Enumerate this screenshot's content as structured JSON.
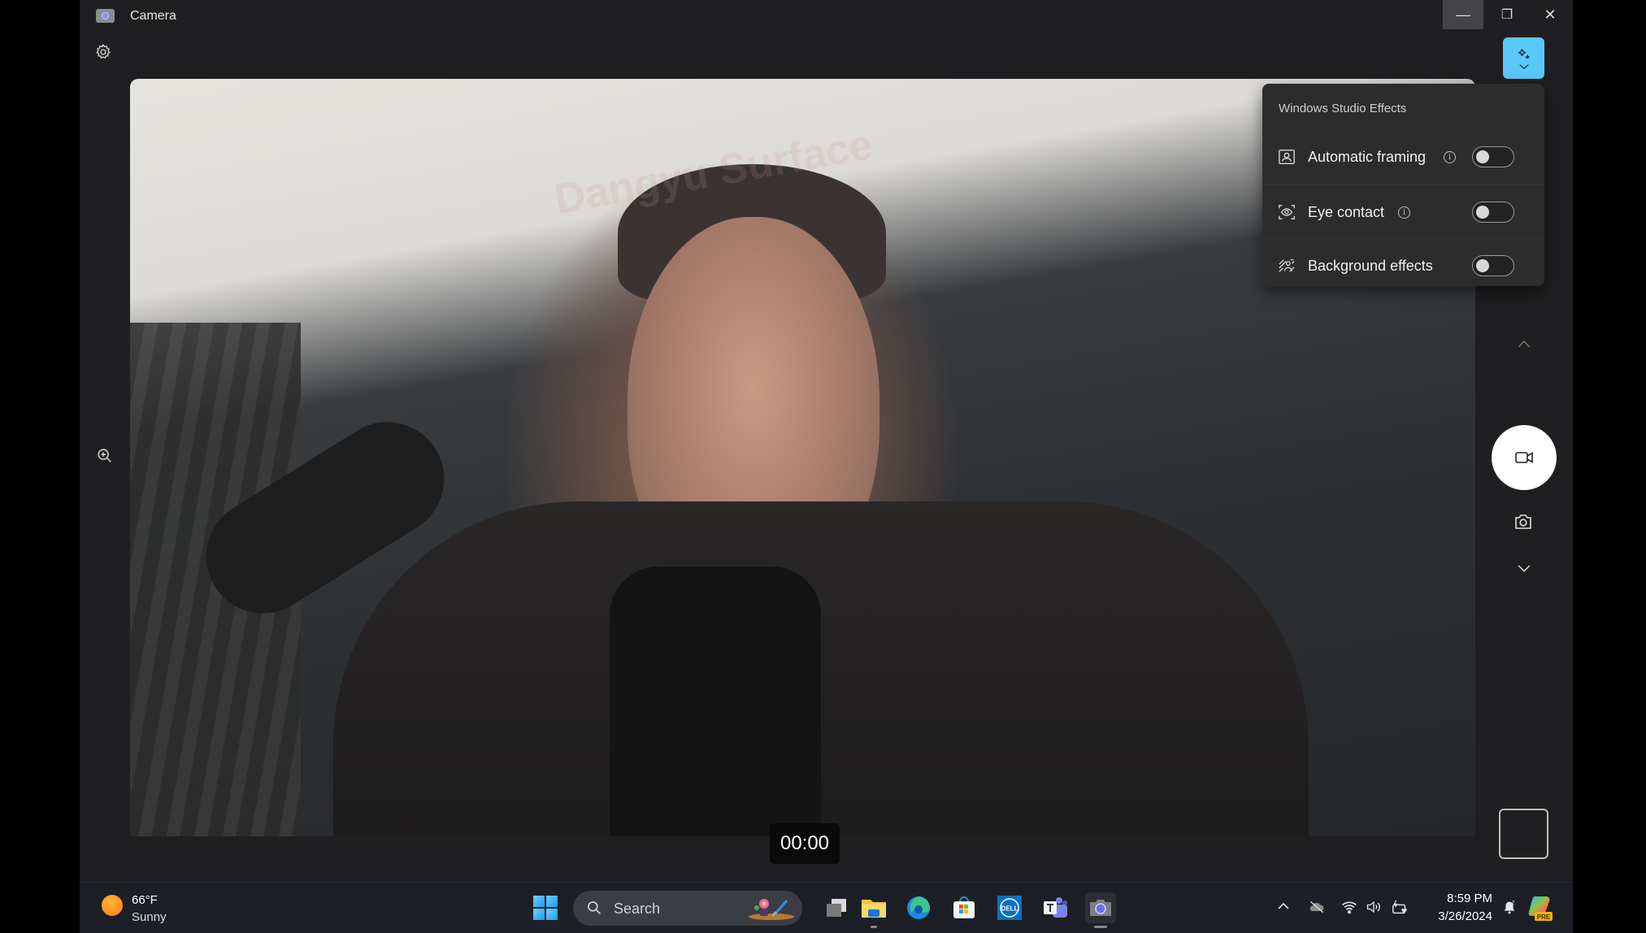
{
  "window": {
    "title": "Camera",
    "controls": {
      "minimize": "—",
      "restore": "❐",
      "close": "✕"
    }
  },
  "video": {
    "watermark": "Dangyu Surface",
    "timer": "00:00"
  },
  "effects": {
    "button_icon": "sparkle-icon",
    "panel_title": "Windows Studio Effects",
    "items": [
      {
        "label": "Automatic framing",
        "icon": "portrait-frame-icon",
        "has_info": true,
        "enabled": false
      },
      {
        "label": "Eye contact",
        "icon": "eye-contact-icon",
        "has_info": true,
        "enabled": false
      },
      {
        "label": "Background effects",
        "icon": "background-blur-icon",
        "has_info": false,
        "enabled": false
      }
    ],
    "info_glyph": "i"
  },
  "camera_controls": {
    "mode_up": "chevron-up-icon",
    "record": "video-camera-icon",
    "photo": "camera-icon",
    "mode_down": "chevron-down-icon"
  },
  "taskbar": {
    "weather": {
      "temp": "66°F",
      "condition": "Sunny"
    },
    "search_placeholder": "Search",
    "apps": [
      {
        "name": "Task View",
        "active": false
      },
      {
        "name": "File Explorer",
        "active": false,
        "running": true
      },
      {
        "name": "Microsoft Edge",
        "active": false
      },
      {
        "name": "Microsoft Store",
        "active": false
      },
      {
        "name": "Dell",
        "active": false,
        "label": "DELL"
      },
      {
        "name": "Microsoft Teams",
        "active": false
      },
      {
        "name": "Camera",
        "active": true,
        "running": true
      }
    ],
    "clock": {
      "time": "8:59 PM",
      "date": "3/26/2024"
    },
    "copilot_badge": "PRE"
  },
  "colors": {
    "accent": "#5ac8fa",
    "window_bg": "#1f1e20",
    "panel_bg": "#2c2c2c",
    "taskbar_bg": "#1c1f25"
  }
}
